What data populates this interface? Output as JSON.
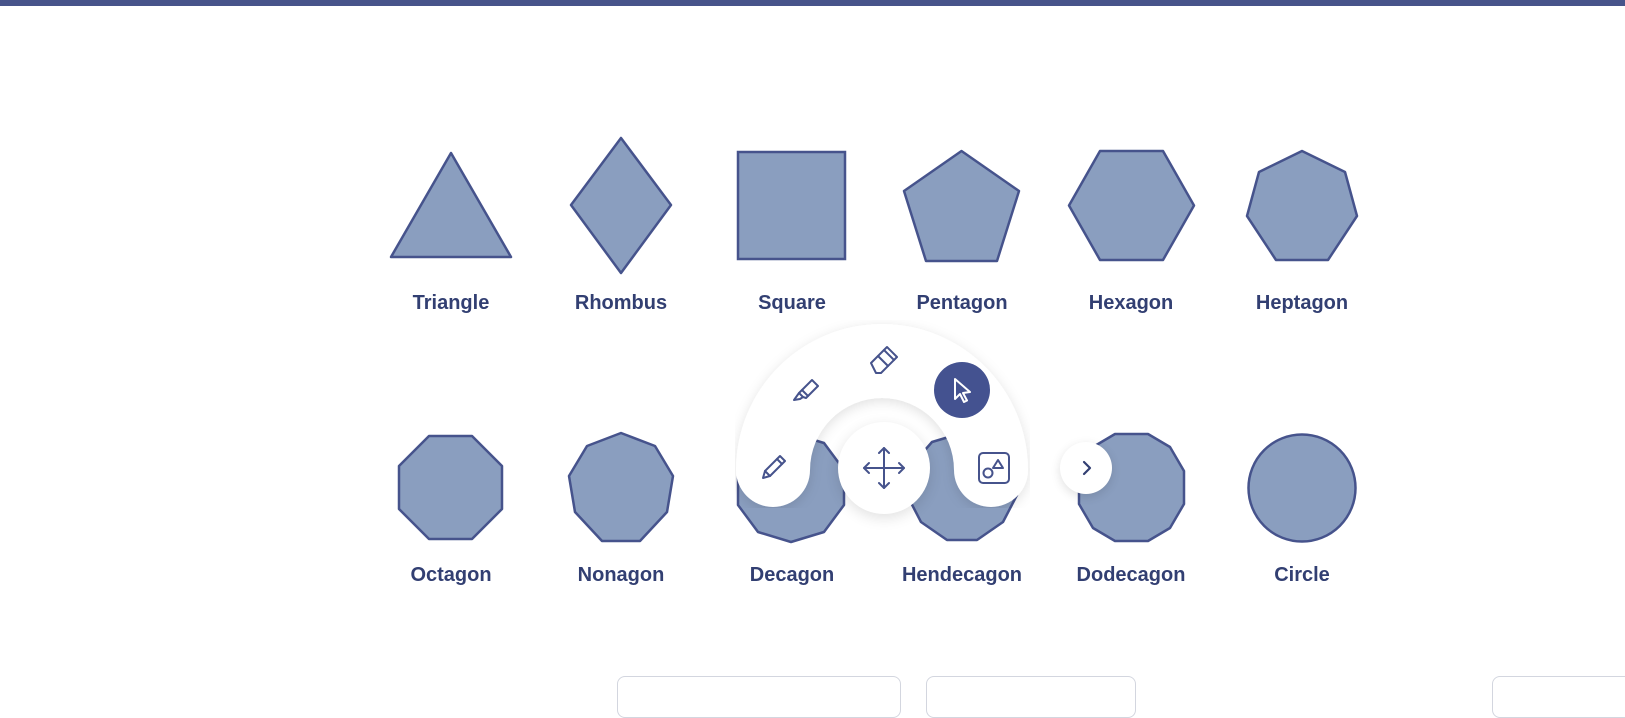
{
  "shapes": {
    "row1": [
      "Triangle",
      "Rhombus",
      "Square",
      "Pentagon",
      "Hexagon",
      "Heptagon"
    ],
    "row2": [
      "Octagon",
      "Nonagon",
      "Decagon",
      "Hendecagon",
      "Dodecagon",
      "Circle"
    ]
  },
  "colors": {
    "shape_fill": "#8a9ebf",
    "shape_stroke": "#46538c",
    "label": "#323f72",
    "accent": "#445290"
  },
  "toolbar": {
    "tools": [
      "pencil-icon",
      "highlighter-icon",
      "eraser-icon",
      "select-pointer-icon",
      "shapes-icon"
    ],
    "active_tool": "select-pointer-icon",
    "center": "move-icon",
    "expand": "chevron-right-icon"
  }
}
